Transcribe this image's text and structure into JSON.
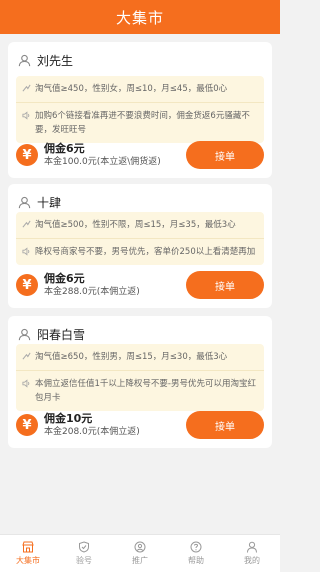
{
  "header": {
    "title": "大集市"
  },
  "colors": {
    "accent": "#f56e1e",
    "requirement_bg": "#fdf6e0"
  },
  "currency_icon": "¥",
  "accept_label": "接单",
  "orders": [
    {
      "name": "刘先生",
      "requirement": "淘气值≥450，性别女，周≤10，月≤45，最低0心",
      "note": "加购6个链接看准再进不要浪费时间，佣金货返6元骚藏不要，发旺旺号",
      "commission": "佣金6元",
      "principal": "本金100.0元(本立返\\佣货返)"
    },
    {
      "name": "十肆",
      "requirement": "淘气值≥500，性别不限，周≤15，月≤35，最低3心",
      "note": "降权号商家号不要，男号优先，客单价250以上看清楚再加",
      "commission": "佣金6元",
      "principal": "本金288.0元(本佣立返)"
    },
    {
      "name": "阳春白雪",
      "requirement": "淘气值≥650，性别男，周≤15，月≤30，最低3心",
      "note": "本佣立返信任值1千以上降权号不要-男号优先可以用淘宝红包月卡",
      "commission": "佣金10元",
      "principal": "本金208.0元(本佣立返)"
    }
  ],
  "tabs": [
    {
      "label": "大集市",
      "icon": "shop-icon",
      "active": true
    },
    {
      "label": "验号",
      "icon": "shield-check-icon",
      "active": false
    },
    {
      "label": "推广",
      "icon": "promote-icon",
      "active": false
    },
    {
      "label": "帮助",
      "icon": "help-icon",
      "active": false
    },
    {
      "label": "我的",
      "icon": "person-icon",
      "active": false
    }
  ]
}
